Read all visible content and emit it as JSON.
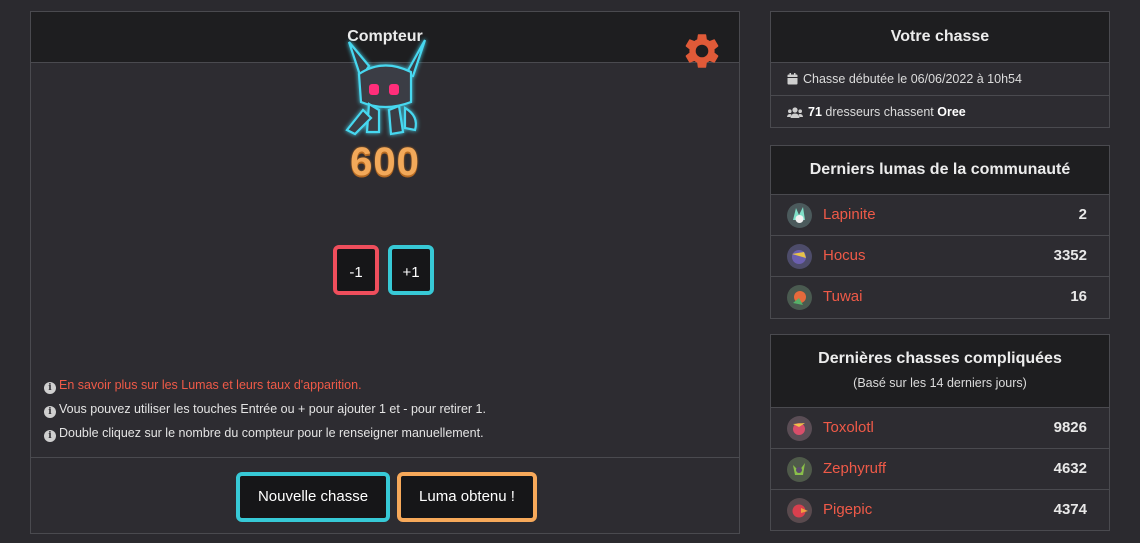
{
  "counter": {
    "title": "Compteur",
    "count": "600",
    "minus_label": "-1",
    "plus_label": "+1",
    "info_link": "En savoir plus sur les Lumas et leurs taux d'apparition.",
    "info_keys": "Vous pouvez utiliser les touches Entrée ou + pour ajouter 1 et - pour retirer 1.",
    "info_dblclick": "Double cliquez sur le nombre du compteur pour le renseigner manuellement.",
    "new_hunt_label": "Nouvelle chasse",
    "luma_obtained_label": "Luma obtenu !"
  },
  "hunt": {
    "title": "Votre chasse",
    "started": "Chasse débutée le 06/06/2022 à 10h54",
    "hunters_count": "71",
    "hunters_text": "dresseurs chassent",
    "species": "Oree"
  },
  "community": {
    "title": "Derniers lumas de la communauté",
    "items": [
      {
        "name": "Lapinite",
        "value": "2"
      },
      {
        "name": "Hocus",
        "value": "3352"
      },
      {
        "name": "Tuwai",
        "value": "16"
      }
    ]
  },
  "hard_hunts": {
    "title": "Dernières chasses compliquées",
    "subtitle": "(Basé sur les 14 derniers jours)",
    "items": [
      {
        "name": "Toxolotl",
        "value": "9826"
      },
      {
        "name": "Zephyruff",
        "value": "4632"
      },
      {
        "name": "Pigepic",
        "value": "4374"
      }
    ]
  },
  "colors": {
    "accent_red": "#ef5a48",
    "accent_cyan": "#37c9d6",
    "accent_orange": "#f7a95a",
    "counter_orange": "#f2a95a"
  },
  "icons": {
    "settings": "gear-icon",
    "calendar": "calendar-icon",
    "users": "users-icon",
    "info": "info-icon"
  }
}
